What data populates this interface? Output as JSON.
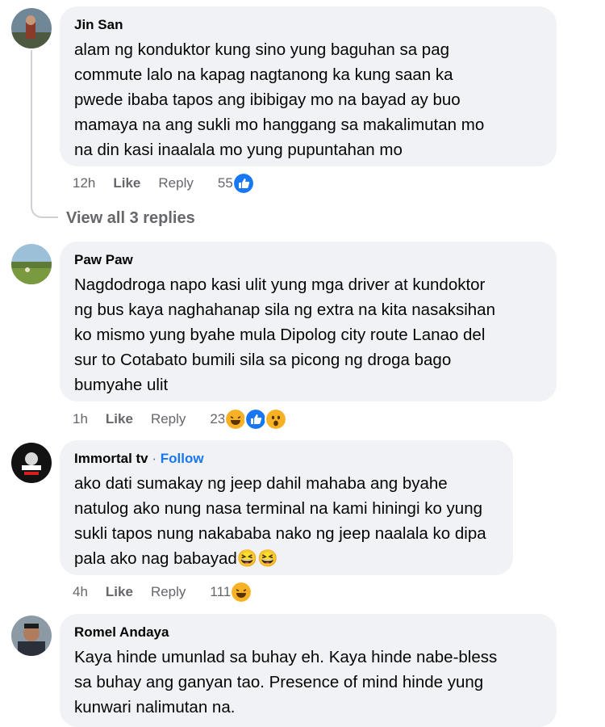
{
  "comments": [
    {
      "author": "Jin San",
      "text": "alam ng konduktor kung sino yung baguhan sa pag\ncommute lalo na kapag nagtanong ka kung saan ka\npwede ibaba tapos ang ibibigay mo na bayad ay buo\nmamaya na ang sukli mo hanggang sa makalimutan mo\nna din kasi inaalala mo yung pupuntahan mo",
      "time": "12h",
      "like_label": "Like",
      "reply_label": "Reply",
      "reaction_count": "55",
      "reactions": [
        "like"
      ]
    },
    {
      "author": "Paw Paw",
      "text": "Nagdodroga napo kasi ulit yung mga driver at kundoktor\nng bus kaya naghahanap sila ng extra na kita nasaksihan\nko mismo yung byahe mula Dipolog city route Lanao del\nsur to Cotabato bumili sila sa picong ng droga bago\nbumyahe ulit",
      "time": "1h",
      "like_label": "Like",
      "reply_label": "Reply",
      "reaction_count": "23",
      "reactions": [
        "haha",
        "like",
        "wow"
      ]
    },
    {
      "author": "Immortal tv",
      "follow_sep": "·",
      "follow_label": "Follow",
      "text": "ako dati sumakay ng jeep dahil mahaba ang byahe\nnatulog ako nung nasa terminal na kami hiningi ko yung\nsukli tapos nung nakababa nako ng jeep naalala ko dipa\npala ako nag babayad😆😆",
      "time": "4h",
      "like_label": "Like",
      "reply_label": "Reply",
      "reaction_count": "111",
      "reactions": [
        "haha"
      ]
    },
    {
      "author": "Romel Andaya",
      "text": "Kaya hinde umunlad sa buhay eh. Kaya hinde nabe-bless\nsa buhay ang ganyan tao. Presence of mind hinde yung\nkunwari nalimutan na."
    }
  ],
  "view_replies_label": "View all 3 replies",
  "colors": {
    "bubble": "#f0f2f5",
    "meta": "#65676b",
    "link": "#1877f2",
    "like": "#1877f2",
    "haha": "#f7b125"
  }
}
